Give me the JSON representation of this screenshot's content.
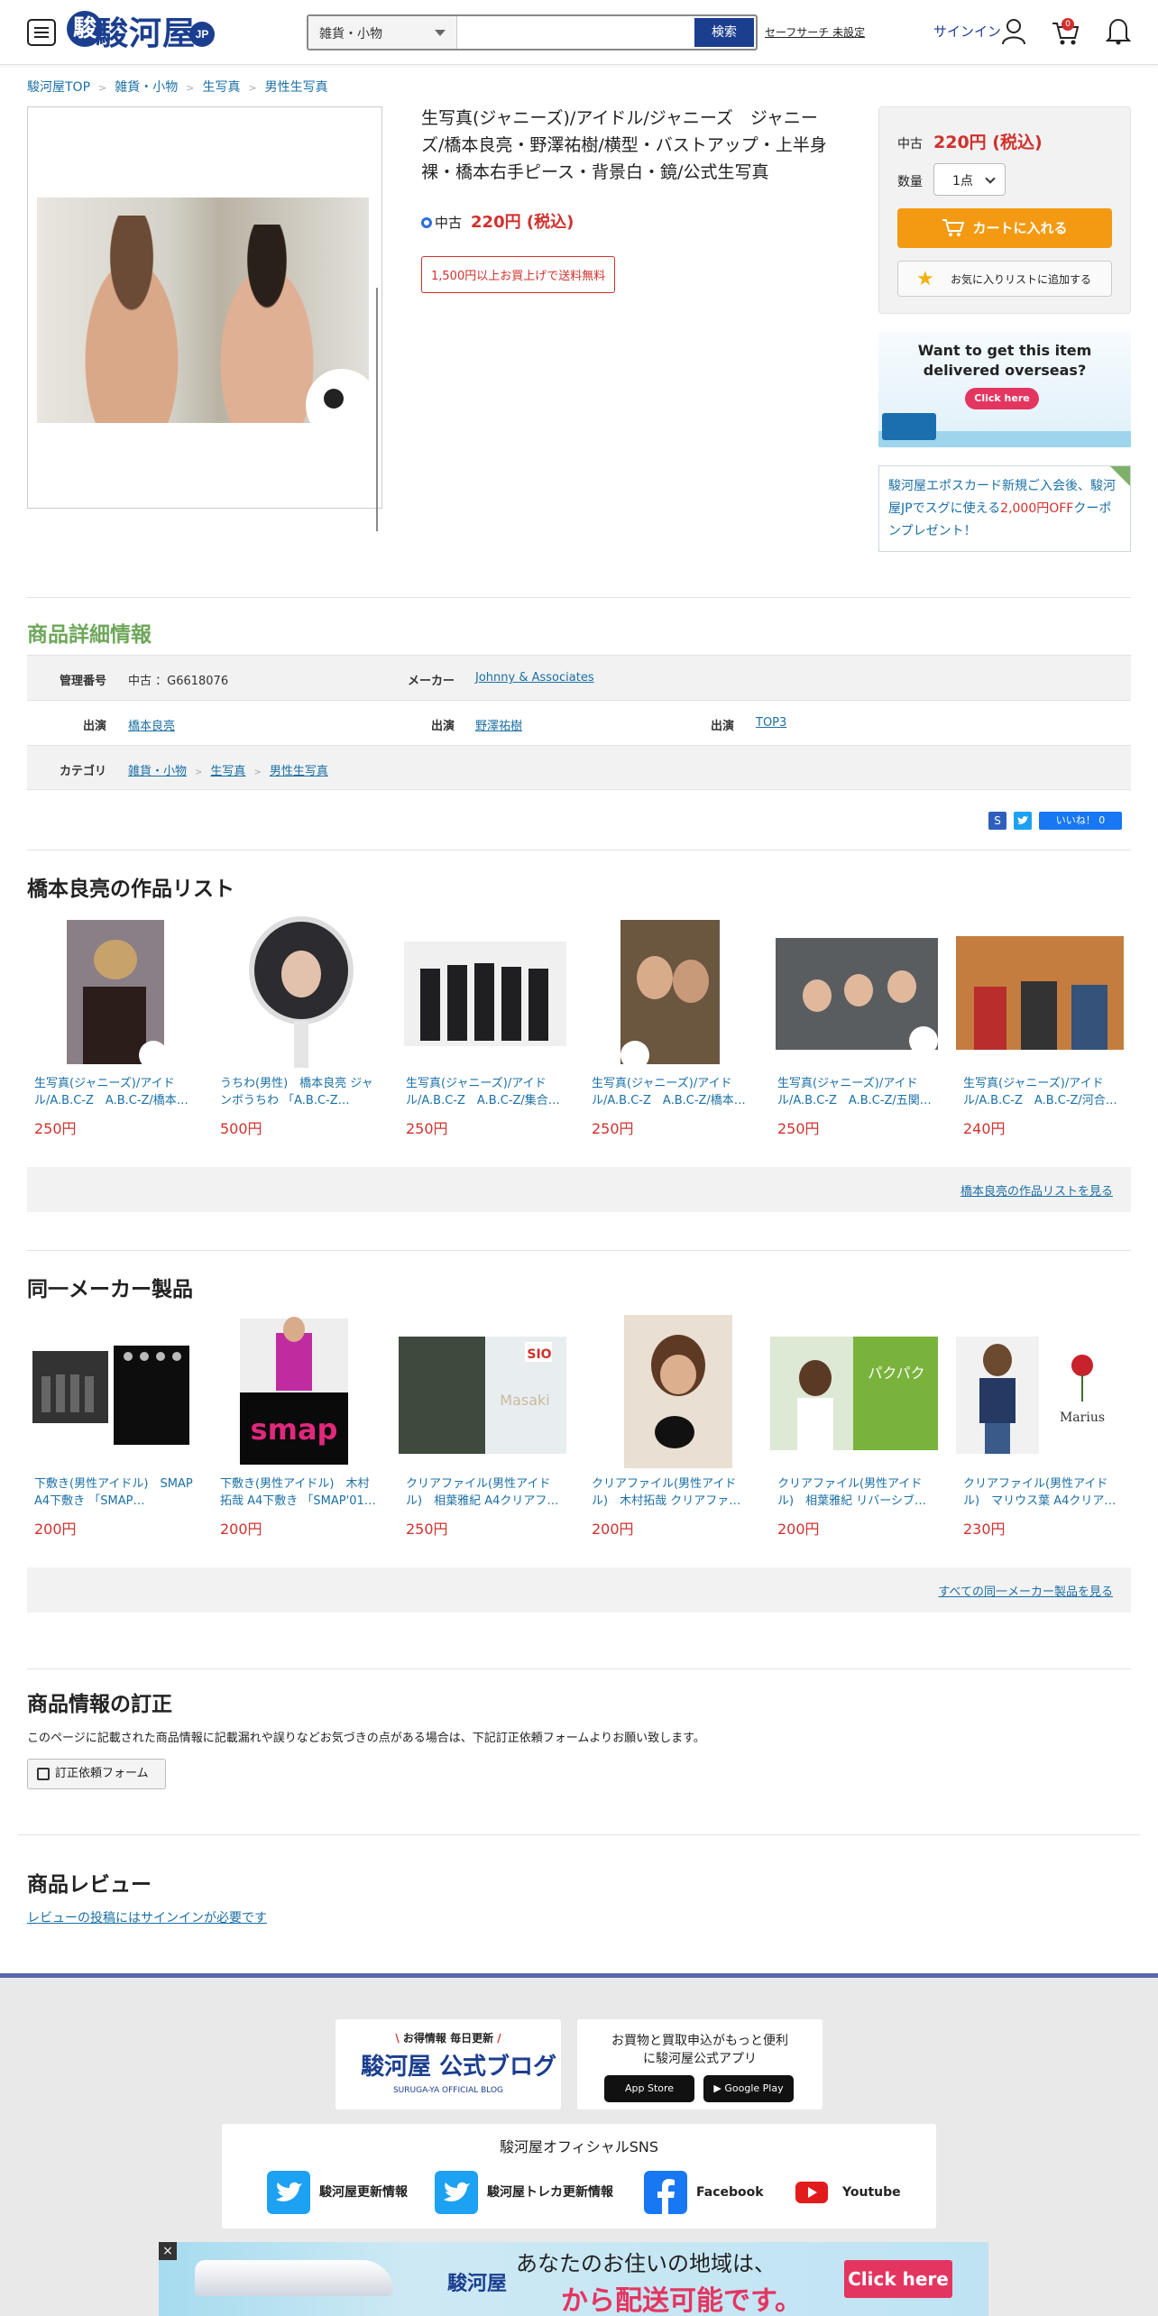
{
  "header": {
    "logo_text": "駿河屋",
    "logo_jp": "JP",
    "search_category": "雑貨・小物",
    "search_placeholder": "",
    "search_button": "検索",
    "safe_search": "セーフサーチ 未設定",
    "signin": "サインイン",
    "cart_count": "0"
  },
  "breadcrumb": [
    "駿河屋TOP",
    "雑貨・小物",
    "生写真",
    "男性生写真"
  ],
  "product": {
    "title": "生写真(ジャニーズ)/アイドル/ジャニーズ　ジャニーズ/橋本良亮・野澤祐樹/横型・バストアップ・上半身裸・橋本右手ピース・背景白・鏡/公式生写真",
    "condition": "中古",
    "price": "220円 (税込)",
    "free_shipping": "1,500円以上お買上げで送料無料"
  },
  "buybox": {
    "condition": "中古",
    "price": "220円 (税込)",
    "qty_label": "数量",
    "qty_value": "1点",
    "cart_button": "カートに入れる",
    "wishlist_button": "お気に入りリストに追加する"
  },
  "overseas": {
    "line1": "Want to get this item",
    "line2": "delivered overseas?",
    "button": "Click here"
  },
  "epos": {
    "text1": "駿河屋エポスカード新規ご入会後、駿河屋JPでスグに使える",
    "red": "2,000円OFF",
    "text2": "クーポンプレゼント！"
  },
  "detail": {
    "heading": "商品詳細情報",
    "mgmt_label": "管理番号",
    "mgmt_value": "中古 ：G6618076",
    "maker_label": "メーカー",
    "maker_value": "Johnny & Associates",
    "cast_label": "出演",
    "cast": [
      "橋本良亮",
      "野澤祐樹",
      "TOP3"
    ],
    "category_label": "カテゴリ",
    "category": [
      "雑貨・小物",
      "生写真",
      "男性生写真"
    ]
  },
  "share": {
    "like": "いいね！ 0"
  },
  "works": {
    "heading": "橋本良亮の作品リスト",
    "more": "橋本良亮の作品リストを見る",
    "items": [
      {
        "name": "生写真(ジャニーズ)/アイドル/A.B.C-Z　A.B.C-Z/橋本…",
        "price": "250円"
      },
      {
        "name": "うちわ(男性)　橋本良亮 ジャンボうちわ 「A.B.C-Z…",
        "price": "500円"
      },
      {
        "name": "生写真(ジャニーズ)/アイドル/A.B.C-Z　A.B.C-Z/集合…",
        "price": "250円"
      },
      {
        "name": "生写真(ジャニーズ)/アイドル/A.B.C-Z　A.B.C-Z/橋本…",
        "price": "250円"
      },
      {
        "name": "生写真(ジャニーズ)/アイドル/A.B.C-Z　A.B.C-Z/五関…",
        "price": "250円"
      },
      {
        "name": "生写真(ジャニーズ)/アイドル/A.B.C-Z　A.B.C-Z/河合…",
        "price": "240円"
      }
    ]
  },
  "maker": {
    "heading": "同一メーカー製品",
    "more": "すべての同一メーカー製品を見る",
    "items": [
      {
        "name": "下敷き(男性アイドル)　SMAP A4下敷き 「SMAP…",
        "price": "200円"
      },
      {
        "name": "下敷き(男性アイドル)　木村拓哉 A4下敷き 「SMAP'01…",
        "price": "200円"
      },
      {
        "name": "クリアファイル(男性アイドル)　相葉雅紀 A4クリアフ…",
        "price": "250円"
      },
      {
        "name": "クリアファイル(男性アイドル)　木村拓哉 クリアファ…",
        "price": "200円"
      },
      {
        "name": "クリアファイル(男性アイドル)　相葉雅紀 リバーシブ…",
        "price": "200円"
      },
      {
        "name": "クリアファイル(男性アイドル)　マリウス葉 A4クリア…",
        "price": "230円"
      }
    ]
  },
  "correction": {
    "heading": "商品情報の訂正",
    "text": "このページに記載された商品情報に記載漏れや誤りなどお気づきの点がある場合は、下記訂正依頼フォームよりお願い致します。",
    "button": "訂正依頼フォーム"
  },
  "review": {
    "heading": "商品レビュー",
    "link": "レビューの投稿にはサインインが必要です"
  },
  "footer": {
    "blog_top": "お得情報 毎日更新",
    "blog_title": "駿河屋 公式ブログ",
    "blog_sub": "SURUGA-YA OFFICIAL BLOG",
    "app_text1": "お買物と買取申込がもっと便利",
    "app_text2": "に駿河屋公式アプリ",
    "app_store": "App Store",
    "google_play": "Google Play",
    "sns_title": "駿河屋オフィシャルSNS",
    "sns": [
      "駿河屋更新情報",
      "駿河屋トレカ更新情報",
      "Facebook",
      "Youtube"
    ]
  },
  "banner": {
    "close": "×",
    "logo": "駿河屋",
    "line1": "あなたのお住いの地域は、",
    "line2": "から配送可能です。",
    "button": "Click here"
  }
}
